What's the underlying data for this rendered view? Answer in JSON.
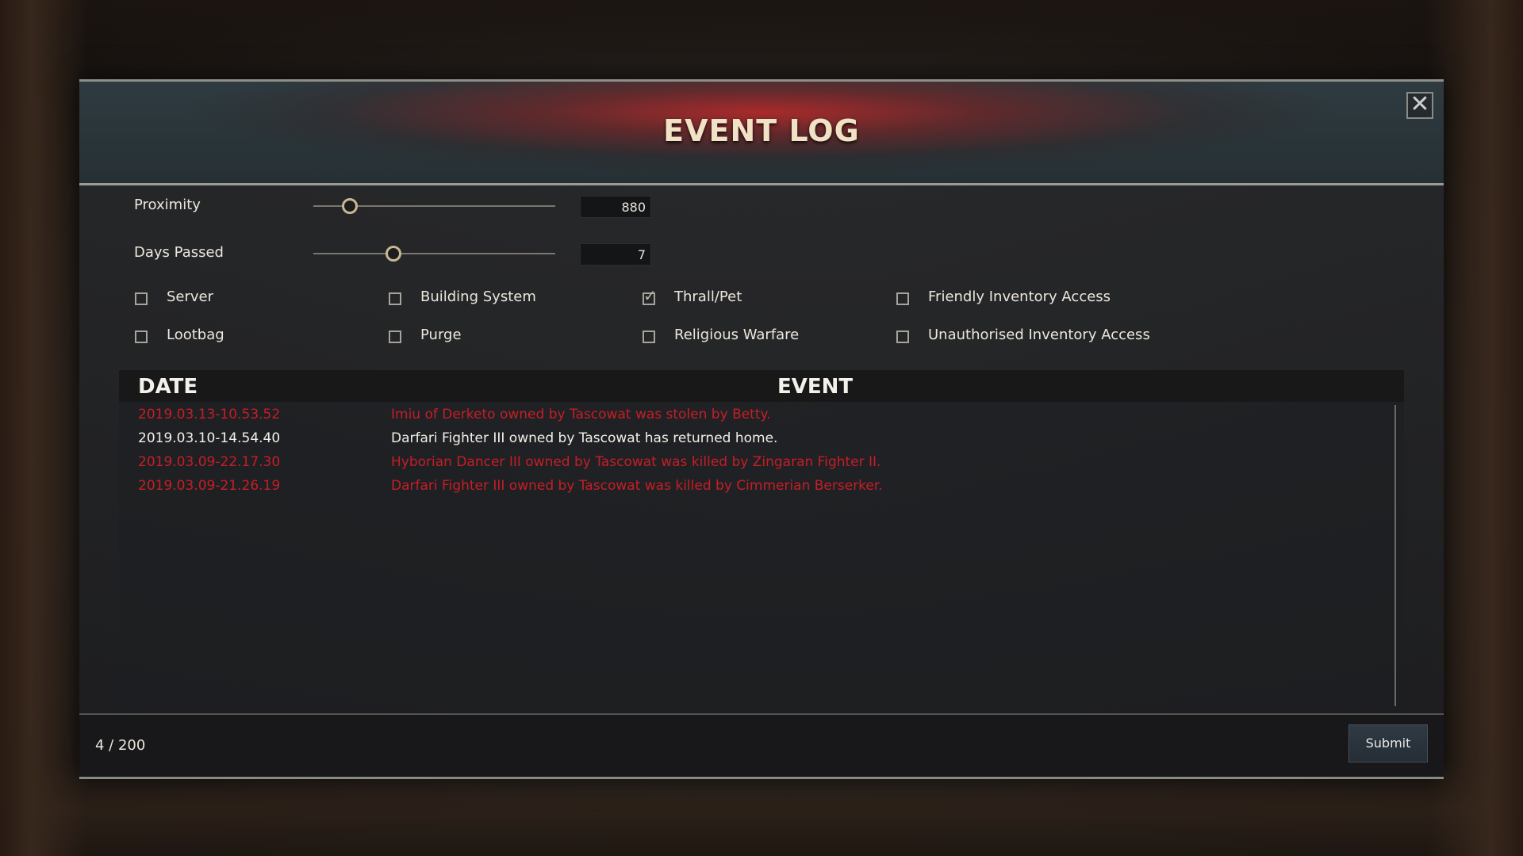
{
  "window": {
    "title": "EVENT LOG",
    "close_label": "✕"
  },
  "filters": {
    "proximity": {
      "label": "Proximity",
      "value": "880",
      "slider_fraction": 0.15
    },
    "days_passed": {
      "label": "Days Passed",
      "value": "7",
      "slider_fraction": 0.33
    }
  },
  "checkboxes": [
    {
      "label": "Server",
      "checked": false
    },
    {
      "label": "Building System",
      "checked": false
    },
    {
      "label": "Thrall/Pet",
      "checked": true
    },
    {
      "label": "Friendly Inventory Access",
      "checked": false
    },
    {
      "label": "Lootbag",
      "checked": false
    },
    {
      "label": "Purge",
      "checked": false
    },
    {
      "label": "Religious Warfare",
      "checked": false
    },
    {
      "label": "Unauthorised Inventory Access",
      "checked": false
    }
  ],
  "table": {
    "date_header": "DATE",
    "event_header": "EVENT",
    "rows": [
      {
        "date": "2019.03.13-10.53.52",
        "event": "Imiu of Derketo owned by Tascowat was stolen by Betty.",
        "color": "#c61e26"
      },
      {
        "date": "2019.03.10-14.54.40",
        "event": "Darfari Fighter III owned by Tascowat has returned home.",
        "color": "#f2efe8"
      },
      {
        "date": "2019.03.09-22.17.30",
        "event": "Hyborian Dancer III owned by Tascowat was killed by Zingaran Fighter II.",
        "color": "#c61e26"
      },
      {
        "date": "2019.03.09-21.26.19",
        "event": "Darfari Fighter III owned by Tascowat was killed by Cimmerian Berserker.",
        "color": "#c61e26"
      }
    ]
  },
  "footer": {
    "count": "4 / 200",
    "submit_label": "Submit"
  }
}
